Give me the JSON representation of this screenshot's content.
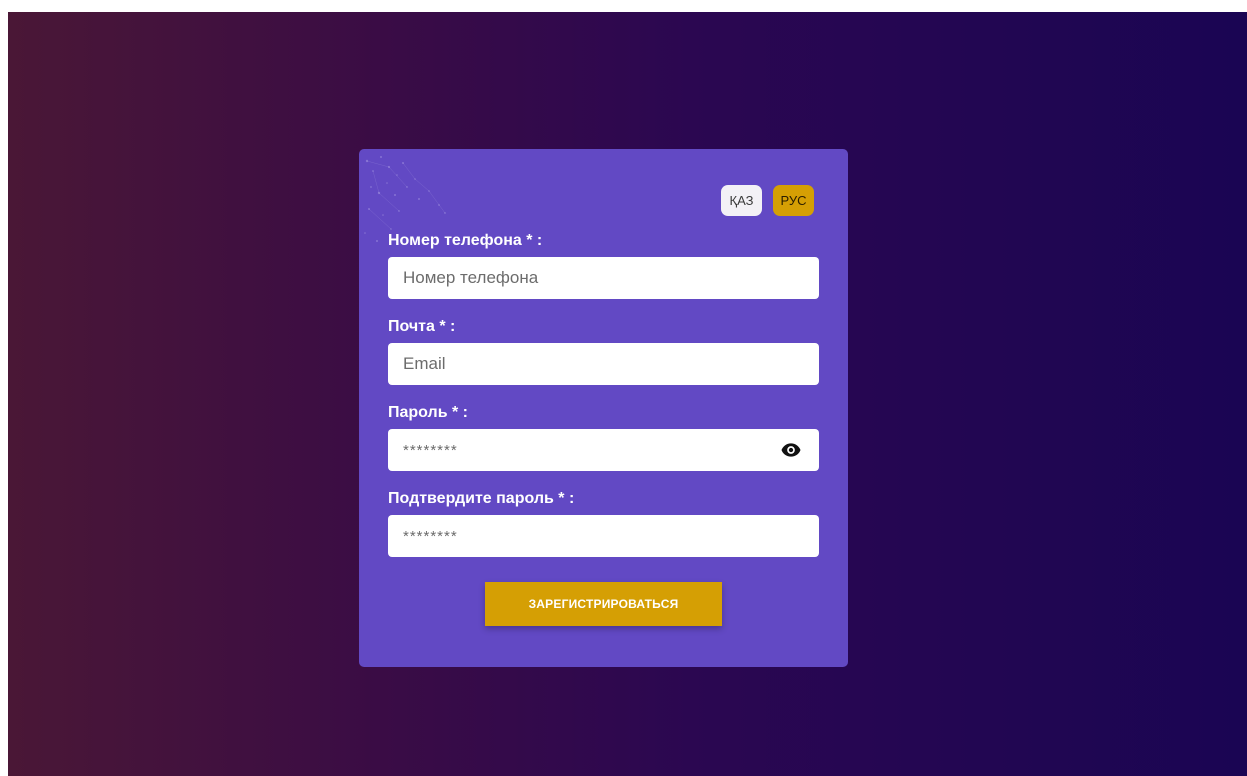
{
  "lang": {
    "kz_label": "ҚАЗ",
    "ru_label": "РУС",
    "active": "ru"
  },
  "form": {
    "phone": {
      "label": "Номер телефона * :",
      "placeholder": "Номер телефона",
      "value": ""
    },
    "email": {
      "label": "Почта * :",
      "placeholder": "Email",
      "value": ""
    },
    "password": {
      "label": "Пароль * :",
      "placeholder": "********",
      "value": ""
    },
    "confirm": {
      "label": "Подтвердите пароль * :",
      "placeholder": "********",
      "value": ""
    },
    "submit_label": "ЗАРЕГИСТРИРОВАТЬСЯ"
  },
  "icons": {
    "password_toggle": "eye-icon"
  },
  "colors": {
    "card_bg": "#6249c4",
    "accent": "#d59f04",
    "gradient_start": "#4a1736",
    "gradient_end": "#1a0553"
  }
}
